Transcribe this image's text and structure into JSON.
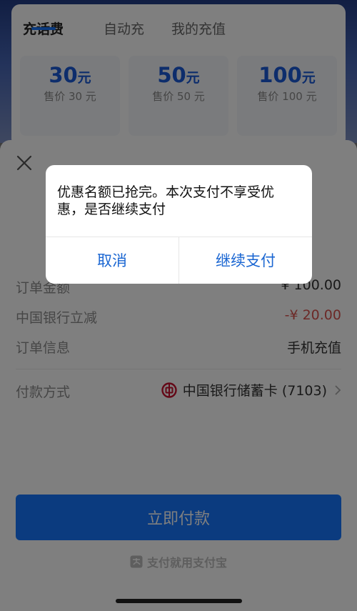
{
  "recharge": {
    "tabs": [
      "充话费",
      "自动充",
      "我的充值"
    ],
    "active_tab": 0,
    "amounts": [
      {
        "value": "30",
        "unit": "元",
        "price": "售价 30 元"
      },
      {
        "value": "50",
        "unit": "元",
        "price": "售价 50 元"
      },
      {
        "value": "100",
        "unit": "元",
        "price": "售价 100 元"
      }
    ]
  },
  "sheet": {
    "order_amount_label": "订单金额",
    "order_amount_value": "¥ 100.00",
    "discount_label": "中国银行立减",
    "discount_value": "-¥ 20.00",
    "order_info_label": "订单信息",
    "order_info_value": "手机充值",
    "payment_method_label": "付款方式",
    "payment_method_value": "中国银行储蓄卡 (7103)",
    "pay_button": "立即付款",
    "brand_text": "支付就用支付宝"
  },
  "dialog": {
    "message": "优惠名额已抢完。本次支付不享受优惠，是否继续支付",
    "cancel": "取消",
    "continue": "继续支付"
  },
  "colors": {
    "accent": "#1677ff",
    "dialog_button": "#1a66d2",
    "discount": "#d9534f"
  }
}
